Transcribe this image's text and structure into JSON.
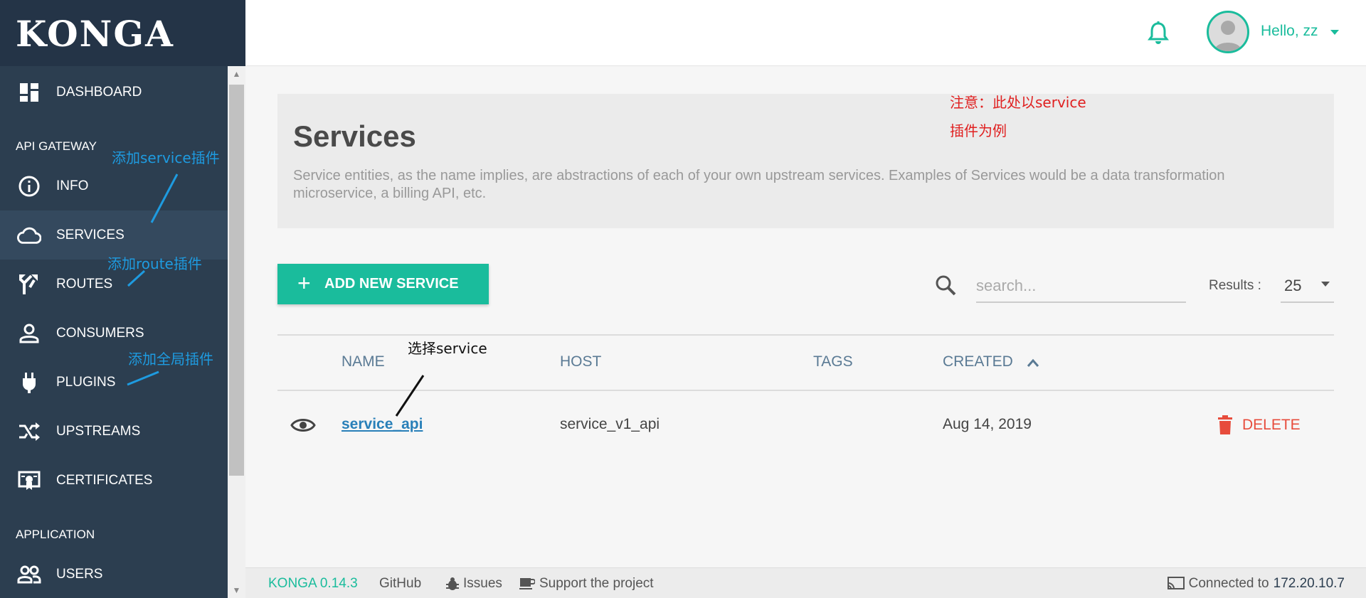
{
  "app": {
    "logo": "KONGA"
  },
  "sidebar": {
    "items_top": [
      {
        "label": "DASHBOARD",
        "icon": "dashboard-icon"
      }
    ],
    "section_api": "API GATEWAY",
    "items_api": [
      {
        "label": "INFO",
        "icon": "info-icon"
      },
      {
        "label": "SERVICES",
        "icon": "cloud-icon",
        "active": true
      },
      {
        "label": "ROUTES",
        "icon": "routes-icon"
      },
      {
        "label": "CONSUMERS",
        "icon": "person-icon"
      },
      {
        "label": "PLUGINS",
        "icon": "plug-icon"
      },
      {
        "label": "UPSTREAMS",
        "icon": "shuffle-icon"
      },
      {
        "label": "CERTIFICATES",
        "icon": "certificate-icon"
      }
    ],
    "section_app": "APPLICATION",
    "items_app": [
      {
        "label": "USERS",
        "icon": "users-icon"
      }
    ]
  },
  "topbar": {
    "greeting": "Hello, zz",
    "bell_icon": "bell-icon",
    "accent": "#1abc9c"
  },
  "page": {
    "title": "Services",
    "description": "Service entities, as the name implies, are abstractions of each of your own upstream services. Examples of Services would be a data transformation microservice, a billing API, etc."
  },
  "toolbar": {
    "add_label": "ADD NEW SERVICE",
    "search_placeholder": "search...",
    "results_label": "Results :",
    "results_value": "25"
  },
  "table": {
    "columns": [
      "NAME",
      "HOST",
      "TAGS",
      "CREATED"
    ],
    "sort_column": "CREATED",
    "rows": [
      {
        "name": "service_api",
        "host": "service_v1_api",
        "tags": "",
        "created": "Aug 14, 2019",
        "action": "DELETE"
      }
    ]
  },
  "footer": {
    "version": "KONGA 0.14.3",
    "github": "GitHub",
    "issues": "Issues",
    "support": "Support the project",
    "connected_label": "Connected to",
    "connected_ip": "172.20.10.7"
  },
  "annotations": {
    "service_plugin": "添加service插件",
    "route_plugin": "添加route插件",
    "global_plugin": "添加全局插件",
    "select_service": "选择service",
    "note_line1": "注意：此处以service",
    "note_line2": "插件为例"
  },
  "colors": {
    "sidebar": "#2c3e50",
    "accent": "#1abc9c",
    "link": "#2980b9",
    "danger": "#e74c3c",
    "annotation_blue": "#1e9be0",
    "annotation_red": "#e02020"
  }
}
